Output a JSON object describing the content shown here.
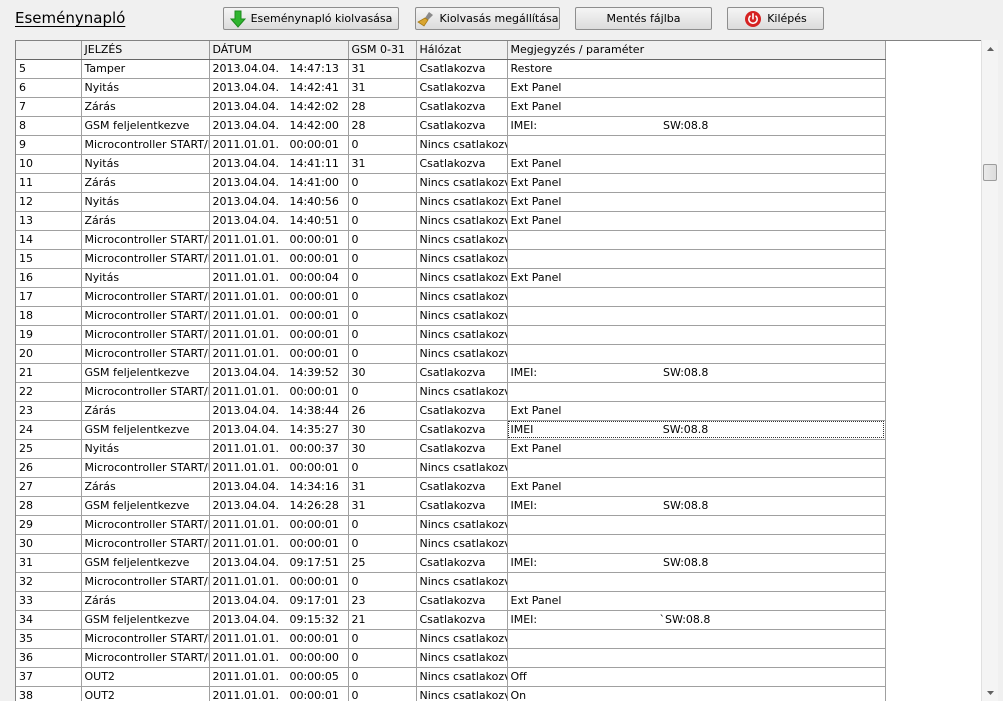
{
  "title": "Eseménynapló",
  "toolbar": {
    "read_label": "Eseménynapló kiolvasása",
    "stop_label": "Kiolvasás megállítása",
    "save_label": "Mentés fájlba",
    "exit_label": "Kilépés"
  },
  "icons": {
    "read": "green-down-arrow-icon",
    "stop": "broom-icon",
    "exit": "red-power-icon"
  },
  "colors": {
    "read_icon": "#2fb52f",
    "exit_icon": "#d62222",
    "stop_icon": "#d9a530"
  },
  "table": {
    "columns": [
      "",
      "JELZÉS",
      "DÁTUM",
      "GSM 0-31",
      "Hálózat",
      "Megjegyzés / paraméter"
    ],
    "rows": [
      [
        "5",
        "Tamper",
        "2013.04.04.   14:47:13",
        "31",
        "Csatlakozva",
        "Restore"
      ],
      [
        "6",
        "Nyitás",
        "2013.04.04.   14:42:41",
        "31",
        "Csatlakozva",
        "Ext Panel"
      ],
      [
        "7",
        "Zárás",
        "2013.04.04.   14:42:02",
        "28",
        "Csatlakozva",
        "Ext Panel"
      ],
      [
        "8",
        "GSM feljelentkezve",
        "2013.04.04.   14:42:00",
        "28",
        "Csatlakozva",
        "IMEI:                                    SW:08.8"
      ],
      [
        "9",
        "Microcontroller START/RESET",
        "2011.01.01.   00:00:01",
        "0",
        "Nincs csatlakozva",
        ""
      ],
      [
        "10",
        "Nyitás",
        "2013.04.04.   14:41:11",
        "31",
        "Csatlakozva",
        "Ext Panel"
      ],
      [
        "11",
        "Zárás",
        "2013.04.04.   14:41:00",
        "0",
        "Nincs csatlakozva",
        "Ext Panel"
      ],
      [
        "12",
        "Nyitás",
        "2013.04.04.   14:40:56",
        "0",
        "Nincs csatlakozva",
        "Ext Panel"
      ],
      [
        "13",
        "Zárás",
        "2013.04.04.   14:40:51",
        "0",
        "Nincs csatlakozva",
        "Ext Panel"
      ],
      [
        "14",
        "Microcontroller START/RESET",
        "2011.01.01.   00:00:01",
        "0",
        "Nincs csatlakozva",
        ""
      ],
      [
        "15",
        "Microcontroller START/RESET",
        "2011.01.01.   00:00:01",
        "0",
        "Nincs csatlakozva",
        ""
      ],
      [
        "16",
        "Nyitás",
        "2011.01.01.   00:00:04",
        "0",
        "Nincs csatlakozva",
        "Ext Panel"
      ],
      [
        "17",
        "Microcontroller START/RESET",
        "2011.01.01.   00:00:01",
        "0",
        "Nincs csatlakozva",
        ""
      ],
      [
        "18",
        "Microcontroller START/RESET",
        "2011.01.01.   00:00:01",
        "0",
        "Nincs csatlakozva",
        ""
      ],
      [
        "19",
        "Microcontroller START/RESET",
        "2011.01.01.   00:00:01",
        "0",
        "Nincs csatlakozva",
        ""
      ],
      [
        "20",
        "Microcontroller START/RESET",
        "2011.01.01.   00:00:01",
        "0",
        "Nincs csatlakozva",
        ""
      ],
      [
        "21",
        "GSM feljelentkezve",
        "2013.04.04.   14:39:52",
        "30",
        "Csatlakozva",
        "IMEI:                                    SW:08.8"
      ],
      [
        "22",
        "Microcontroller START/RESET",
        "2011.01.01.   00:00:01",
        "0",
        "Nincs csatlakozva",
        ""
      ],
      [
        "23",
        "Zárás",
        "2013.04.04.   14:38:44",
        "26",
        "Csatlakozva",
        "Ext Panel"
      ],
      [
        "24",
        "GSM feljelentkezve",
        "2013.04.04.   14:35:27",
        "30",
        "Csatlakozva",
        "IMEI                                     SW:08.8"
      ],
      [
        "25",
        "Nyitás",
        "2011.01.01.   00:00:37",
        "30",
        "Csatlakozva",
        "Ext Panel"
      ],
      [
        "26",
        "Microcontroller START/RESET",
        "2011.01.01.   00:00:01",
        "0",
        "Nincs csatlakozva",
        ""
      ],
      [
        "27",
        "Zárás",
        "2013.04.04.   14:34:16",
        "31",
        "Csatlakozva",
        "Ext Panel"
      ],
      [
        "28",
        "GSM feljelentkezve",
        "2013.04.04.   14:26:28",
        "31",
        "Csatlakozva",
        "IMEI:                                    SW:08.8"
      ],
      [
        "29",
        "Microcontroller START/RESET",
        "2011.01.01.   00:00:01",
        "0",
        "Nincs csatlakozva",
        ""
      ],
      [
        "30",
        "Microcontroller START/RESET",
        "2011.01.01.   00:00:01",
        "0",
        "Nincs csatlakozva",
        ""
      ],
      [
        "31",
        "GSM feljelentkezve",
        "2013.04.04.   09:17:51",
        "25",
        "Csatlakozva",
        "IMEI:                                    SW:08.8"
      ],
      [
        "32",
        "Microcontroller START/RESET",
        "2011.01.01.   00:00:01",
        "0",
        "Nincs csatlakozva",
        ""
      ],
      [
        "33",
        "Zárás",
        "2013.04.04.   09:17:01",
        "23",
        "Csatlakozva",
        "Ext Panel"
      ],
      [
        "34",
        "GSM feljelentkezve",
        "2013.04.04.   09:15:32",
        "21",
        "Csatlakozva",
        "IMEI:                                   `SW:08.8"
      ],
      [
        "35",
        "Microcontroller START/RESET",
        "2011.01.01.   00:00:01",
        "0",
        "Nincs csatlakozva",
        ""
      ],
      [
        "36",
        "Microcontroller START/RESET",
        "2011.01.01.   00:00:00",
        "0",
        "Nincs csatlakozva",
        ""
      ],
      [
        "37",
        "OUT2",
        "2011.01.01.   00:00:05",
        "0",
        "Nincs csatlakozva",
        "Off"
      ],
      [
        "38",
        "OUT2",
        "2011.01.01.   00:00:01",
        "0",
        "Nincs csatlakozva",
        "On"
      ]
    ],
    "focused_row": "24"
  }
}
